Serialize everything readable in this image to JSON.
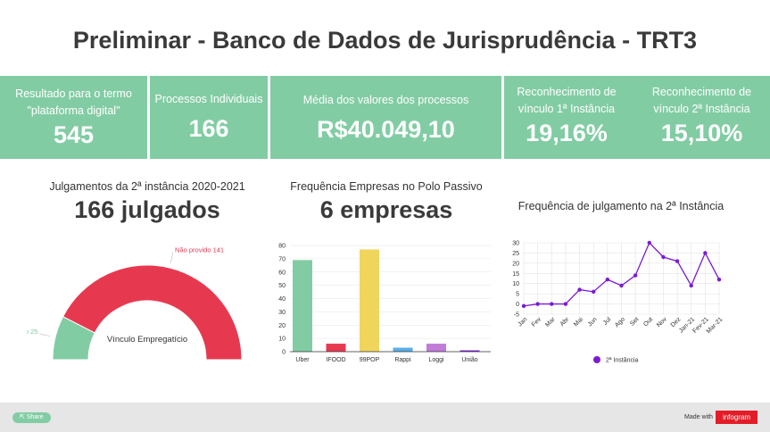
{
  "title": "Preliminar - Banco de Dados de Jurisprudência - TRT3",
  "kpis": [
    {
      "label_lines": [
        "Resultado para o termo",
        "\"plataforma digital\""
      ],
      "value": "545"
    },
    {
      "label_lines": [
        "Processos Individuais"
      ],
      "value": "166"
    },
    {
      "label_lines": [
        "Média dos valores dos processos"
      ],
      "value": "R$40.049,10"
    },
    {
      "label_lines": [
        "Reconhecimento de",
        "vínculo 1ª Instância"
      ],
      "value": "19,16%"
    },
    {
      "label_lines": [
        "Reconhecimento de",
        "vínculo 2ª Instância"
      ],
      "value": "15,10%"
    }
  ],
  "sections": {
    "julgamentos": {
      "title": "Julgamentos da 2ª instância 2020-2021",
      "big": "166 julgados"
    },
    "empresas": {
      "title": "Frequência Empresas no Polo Passivo",
      "big": "6 empresas"
    },
    "frequencia": {
      "title": "Frequência de julgamento na 2ª Instância"
    }
  },
  "footer": {
    "share_label": "Share",
    "made_with": "Made with",
    "brand": "infogram"
  },
  "colors": {
    "kpi_bg": "#82cca4",
    "red": "#e63950",
    "green": "#82cca4",
    "purple": "#7a1bd4",
    "footer_bg": "#e6e6e6",
    "brand_red": "#e31d28"
  },
  "chart_data": [
    {
      "type": "pie",
      "variant": "semi-donut",
      "center_label": "Vínculo Empregatício",
      "slices": [
        {
          "label": "Provido",
          "value": 25,
          "color": "#82cca4"
        },
        {
          "label": "Não provido",
          "value": 141,
          "color": "#e63950"
        }
      ]
    },
    {
      "type": "bar",
      "categories": [
        "Uber",
        "IFOOD",
        "99POP",
        "Rappi",
        "Loggi",
        "União"
      ],
      "values": [
        69,
        6,
        77,
        3,
        6,
        1
      ],
      "colors": [
        "#82cca4",
        "#e63950",
        "#f0d55c",
        "#5aaee6",
        "#c07cd6",
        "#7a1bd4"
      ],
      "ylim": [
        0,
        80
      ],
      "yticks": [
        0,
        10,
        20,
        30,
        40,
        50,
        60,
        70,
        80
      ],
      "grid": true
    },
    {
      "type": "line",
      "categories": [
        "Jan",
        "Fev",
        "Mar",
        "Abr",
        "Mai",
        "Jun",
        "Jul",
        "Ago",
        "Set",
        "Out",
        "Nov",
        "Dez",
        "Jan-21",
        "Fev-21",
        "Mar-21"
      ],
      "series": [
        {
          "name": "2ª Instância",
          "values": [
            -1,
            0,
            0,
            0,
            7,
            6,
            12,
            9,
            14,
            30,
            23,
            21,
            9,
            25,
            12
          ],
          "color": "#7a1bd4"
        }
      ],
      "ylim": [
        -5,
        30
      ],
      "yticks": [
        -5,
        0,
        5,
        10,
        15,
        20,
        25,
        30
      ],
      "grid": true,
      "legend": "bottom"
    }
  ]
}
